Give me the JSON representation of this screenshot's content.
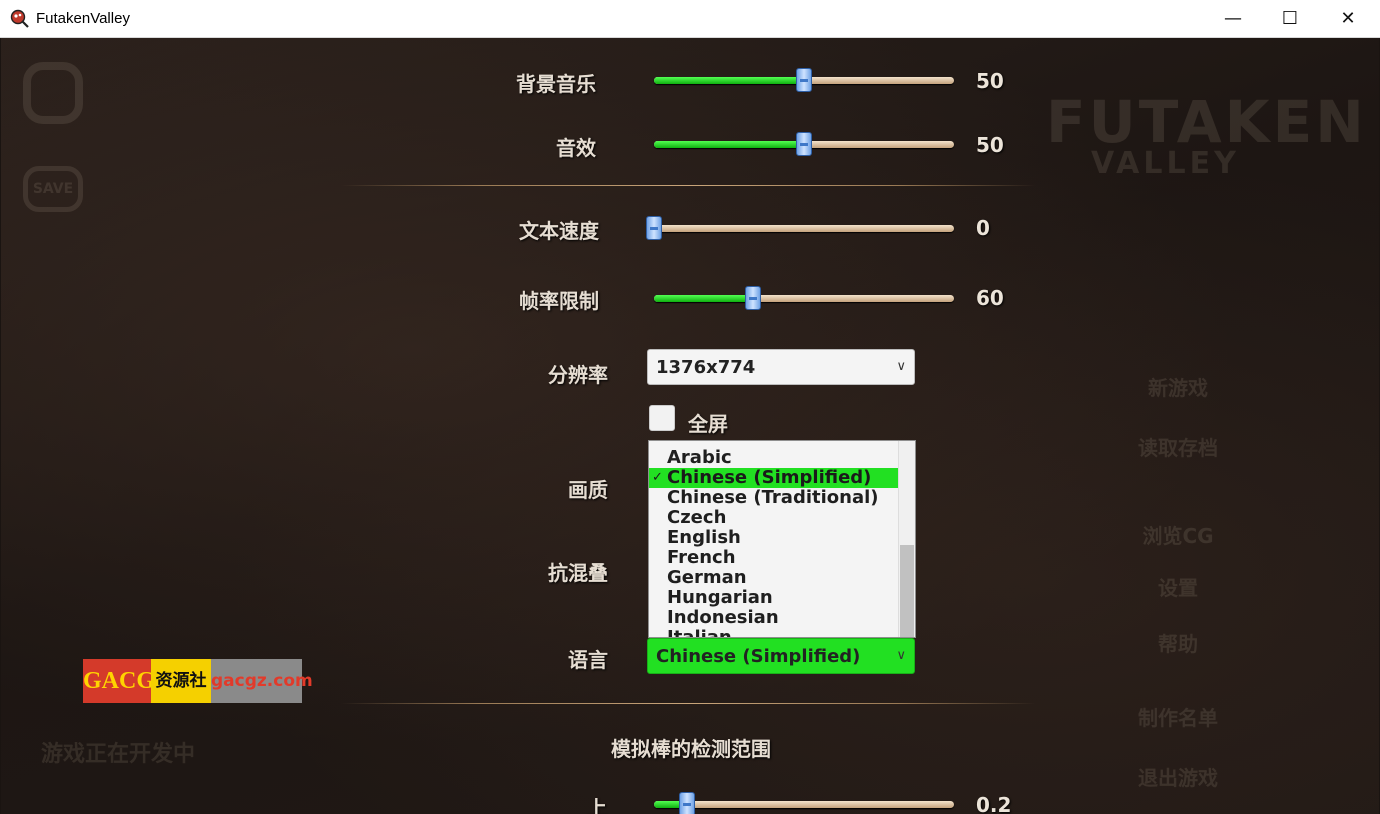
{
  "window": {
    "title": "FutakenValley",
    "minimize": "—",
    "maximize": "☐",
    "close": "✕"
  },
  "background": {
    "logo_top": "FUTAKEN",
    "logo_bottom": "VALLEY",
    "side_icons": [
      "game-controller-icon",
      "save-icon"
    ],
    "save_icon_text": "SAVE",
    "dev_notice": "游戏正在开发中",
    "menu": [
      "新游戏",
      "读取存档",
      "浏览CG",
      "设置",
      "帮助",
      "制作名单",
      "退出游戏"
    ]
  },
  "settings": {
    "bgm": {
      "label": "背景音乐",
      "value": "50",
      "level": 0.5
    },
    "sfx": {
      "label": "音效",
      "value": "50",
      "level": 0.5
    },
    "text_speed": {
      "label": "文本速度",
      "value": "0",
      "level": 0.0
    },
    "fps_limit": {
      "label": "帧率限制",
      "value": "60",
      "level": 0.33
    },
    "resolution": {
      "label": "分辨率",
      "value": "1376x774"
    },
    "fullscreen": {
      "label": "全屏",
      "checked": false
    },
    "quality": {
      "label": "画质"
    },
    "antialias": {
      "label": "抗混叠"
    },
    "language": {
      "label": "语言",
      "value": "Chinese (Simplified)",
      "options": [
        "Arabic",
        "Chinese (Simplified)",
        "Chinese (Traditional)",
        "Czech",
        "English",
        "French",
        "German",
        "Hungarian",
        "Indonesian",
        "Italian"
      ],
      "selected_index": 1
    },
    "stick_section": {
      "title": "模拟棒的检测范围"
    },
    "stick_up": {
      "label": "上",
      "value": "0.2",
      "level": 0.11
    }
  },
  "watermark": {
    "part1": "GACG",
    "part2": "资源社",
    "part3": "gacgz.com"
  },
  "colors": {
    "accent_green": "#22e022",
    "thumb_blue": "#6fa2e6",
    "divider_gold": "#c9a57a"
  }
}
